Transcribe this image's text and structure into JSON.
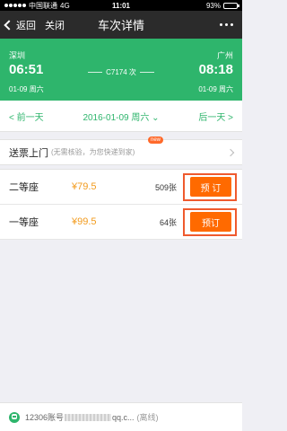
{
  "status_bar": {
    "carrier": "中国联通",
    "network": "4G",
    "time": "11:01",
    "battery": "93%",
    "battery_level": 0.93
  },
  "nav": {
    "back_label": "返回",
    "close_label": "关闭",
    "title": "车次详情"
  },
  "train": {
    "from_city": "深圳",
    "to_city": "广州",
    "depart_time": "06:51",
    "arrive_time": "08:18",
    "train_no": "C7174 次",
    "depart_date": "01-09  周六",
    "arrive_date": "01-09  周六",
    "brand_color": "#2eb56c"
  },
  "date_bar": {
    "prev": "前一天",
    "current": "2016-01-09 周六",
    "next": "后一天"
  },
  "delivery": {
    "title": "送票上门",
    "subtitle": "(无需核验，为您快递到家)",
    "badge": "new"
  },
  "seats": [
    {
      "name": "二等座",
      "price": "¥79.5",
      "count": "509张",
      "book_label": "预 订"
    },
    {
      "name": "一等座",
      "price": "¥99.5",
      "count": "64张",
      "book_label": "预订"
    }
  ],
  "footer": {
    "account_prefix": "12306账号",
    "account_suffix": "qq.c...",
    "status": "(离线)"
  },
  "colors": {
    "accent_green": "#2eb56c",
    "book_orange": "#ff6a00",
    "highlight_border": "#ef5a2e",
    "price_orange": "#f29b1e"
  }
}
